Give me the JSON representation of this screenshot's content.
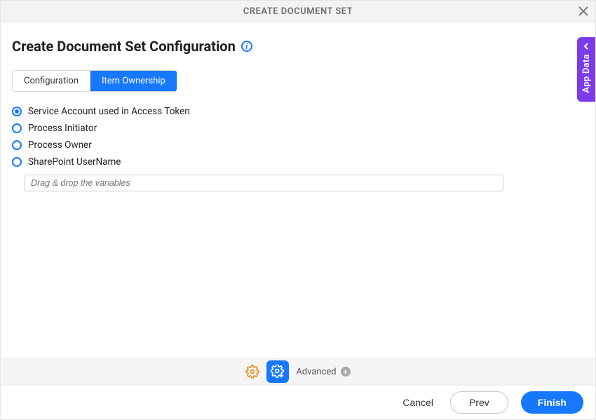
{
  "header": {
    "title": "CREATE DOCUMENT SET"
  },
  "page": {
    "title": "Create Document Set Configuration"
  },
  "tabs": {
    "configuration": "Configuration",
    "item_ownership": "Item Ownership",
    "active": 1
  },
  "radios": {
    "options": [
      "Service Account used in Access Token",
      "Process Initiator",
      "Process Owner",
      "SharePoint UserName"
    ],
    "selected": 0
  },
  "var_input": {
    "placeholder": "Drag & drop the variables",
    "value": ""
  },
  "advanced": {
    "label": "Advanced"
  },
  "footer": {
    "cancel": "Cancel",
    "prev": "Prev",
    "finish": "Finish"
  },
  "side_tab": {
    "label": "App Data"
  }
}
